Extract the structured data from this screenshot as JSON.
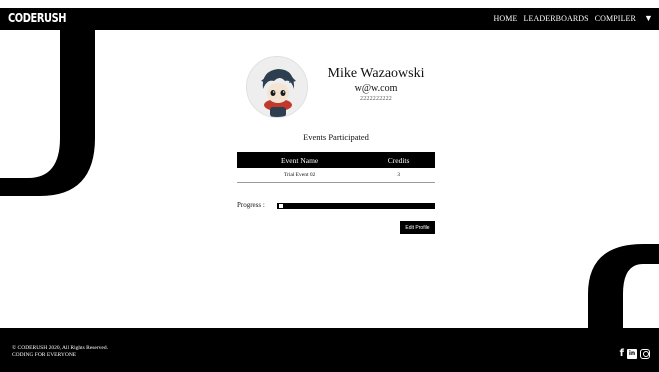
{
  "brand": "CODERUSH",
  "nav": {
    "home": "HOME",
    "leaderboards": "LEADERBOARDS",
    "compiler": "COMPILER",
    "menu_icon": "caret-down-icon"
  },
  "profile": {
    "name": "Mike Wazaowski",
    "email": "w@w.com",
    "phone": "2222222222"
  },
  "events": {
    "title": "Events Participated",
    "columns": [
      "Event Name",
      "Credits"
    ],
    "rows": [
      {
        "event": "Trial Event 02",
        "credits": "3"
      }
    ]
  },
  "progress": {
    "label": "Progress :",
    "fraction": 0.02
  },
  "edit_button": "Edit Profile",
  "footer": {
    "copyright": "© CODERUSH 2020, All Rights Reserved.",
    "tagline": "CODING FOR EVERYONE",
    "social_icons": [
      "facebook-icon",
      "linkedin-icon",
      "instagram-icon"
    ]
  },
  "colors": {
    "bar": "#000000",
    "background": "#ffffff",
    "text_light": "#ffffff"
  }
}
